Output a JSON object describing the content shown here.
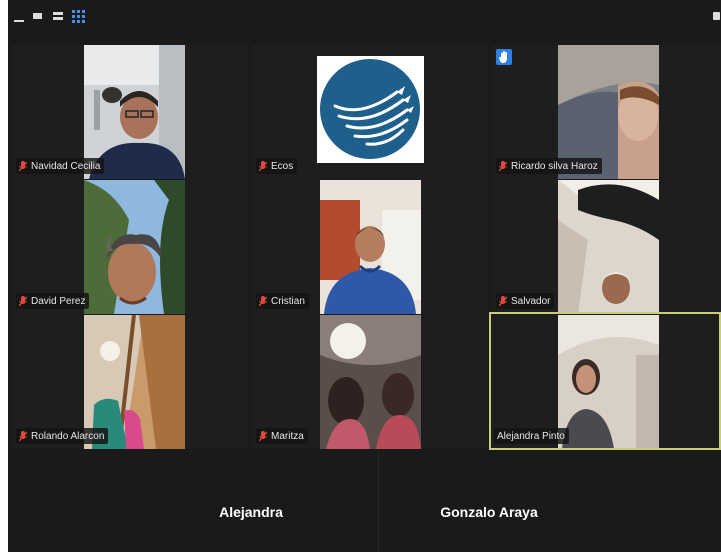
{
  "window": {
    "toolbar": {
      "minimize_icon": "minimize-icon",
      "speaker_view_icon": "speaker-view-icon",
      "strip_view_icon": "strip-view-icon",
      "gallery_view_icon": "gallery-view-icon",
      "exit_fullscreen_icon": "exit-fullscreen-icon",
      "gallery_icon_color": "#4a8fe6"
    },
    "active_speaker_border_color": "#c9cf77",
    "raised_hand_color": "#2f7ee6",
    "muted_mic_color": "#e34a3f"
  },
  "gallery": {
    "participants": [
      {
        "name": "Navidad Cecilia",
        "muted": true
      },
      {
        "name": "Ecos",
        "muted": true
      },
      {
        "name": "Ricardo silva Haroz",
        "muted": true,
        "hand_raised": true
      },
      {
        "name": "David Perez",
        "muted": true
      },
      {
        "name": "Cristian",
        "muted": true
      },
      {
        "name": "Salvador",
        "muted": true
      },
      {
        "name": "Rolando Alarcon",
        "muted": true
      },
      {
        "name": "Maritza",
        "muted": true
      },
      {
        "name": "Alejandra Pinto",
        "muted": false,
        "active_speaker": true
      }
    ]
  },
  "bottom_row": {
    "participants": [
      {
        "name": "Alejandra"
      },
      {
        "name": "Gonzalo Araya"
      }
    ]
  }
}
